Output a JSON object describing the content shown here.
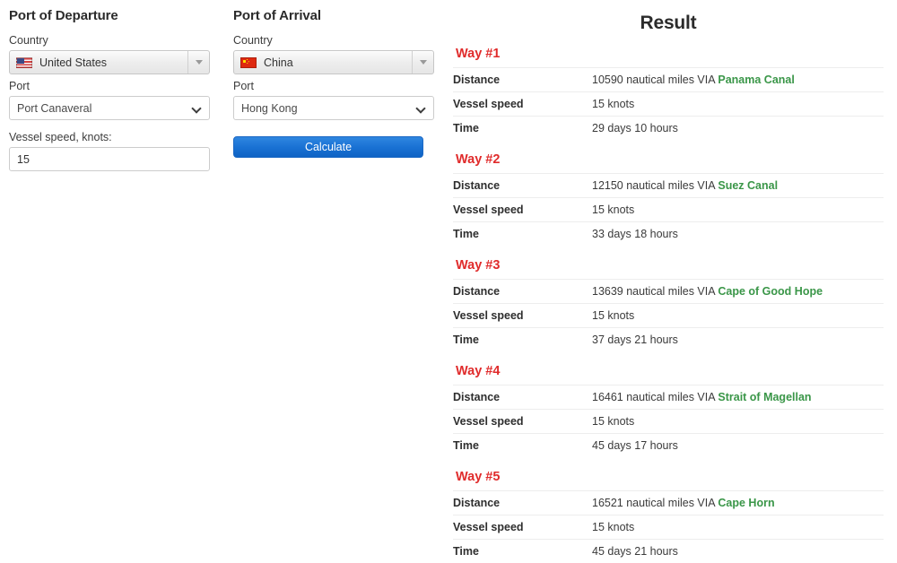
{
  "departure": {
    "title": "Port of Departure",
    "country_label": "Country",
    "country_value": "United States",
    "country_flag": "flag-united-states-icon",
    "port_label": "Port",
    "port_value": "Port Canaveral",
    "speed_label": "Vessel speed, knots:",
    "speed_value": "15"
  },
  "arrival": {
    "title": "Port of Arrival",
    "country_label": "Country",
    "country_value": "China",
    "country_flag": "flag-china-icon",
    "port_label": "Port",
    "port_value": "Hong Kong",
    "calculate_label": "Calculate"
  },
  "result": {
    "title": "Result",
    "row_labels": {
      "distance": "Distance",
      "vessel_speed": "Vessel speed",
      "time": "Time"
    },
    "ways": [
      {
        "heading": "Way #1",
        "distance_prefix": "10590 nautical miles VIA ",
        "distance_value": "10590",
        "distance_unit": "nautical miles",
        "via": "Panama Canal",
        "vessel_speed": "15 knots",
        "time": "29 days 10 hours"
      },
      {
        "heading": "Way #2",
        "distance_prefix": "12150 nautical miles VIA ",
        "distance_value": "12150",
        "distance_unit": "nautical miles",
        "via": "Suez Canal",
        "vessel_speed": "15 knots",
        "time": "33 days 18 hours"
      },
      {
        "heading": "Way #3",
        "distance_prefix": "13639 nautical miles VIA ",
        "distance_value": "13639",
        "distance_unit": "nautical miles",
        "via": "Cape of Good Hope",
        "vessel_speed": "15 knots",
        "time": "37 days 21 hours"
      },
      {
        "heading": "Way #4",
        "distance_prefix": "16461 nautical miles VIA ",
        "distance_value": "16461",
        "distance_unit": "nautical miles",
        "via": "Strait of Magellan",
        "vessel_speed": "15 knots",
        "time": "45 days 17 hours"
      },
      {
        "heading": "Way #5",
        "distance_prefix": "16521 nautical miles VIA ",
        "distance_value": "16521",
        "distance_unit": "nautical miles",
        "via": "Cape Horn",
        "vessel_speed": "15 knots",
        "time": "45 days 21 hours"
      }
    ]
  },
  "colors": {
    "way_heading": "#e02b2b",
    "via_route": "#3a9648",
    "button": "#1a72d4"
  }
}
